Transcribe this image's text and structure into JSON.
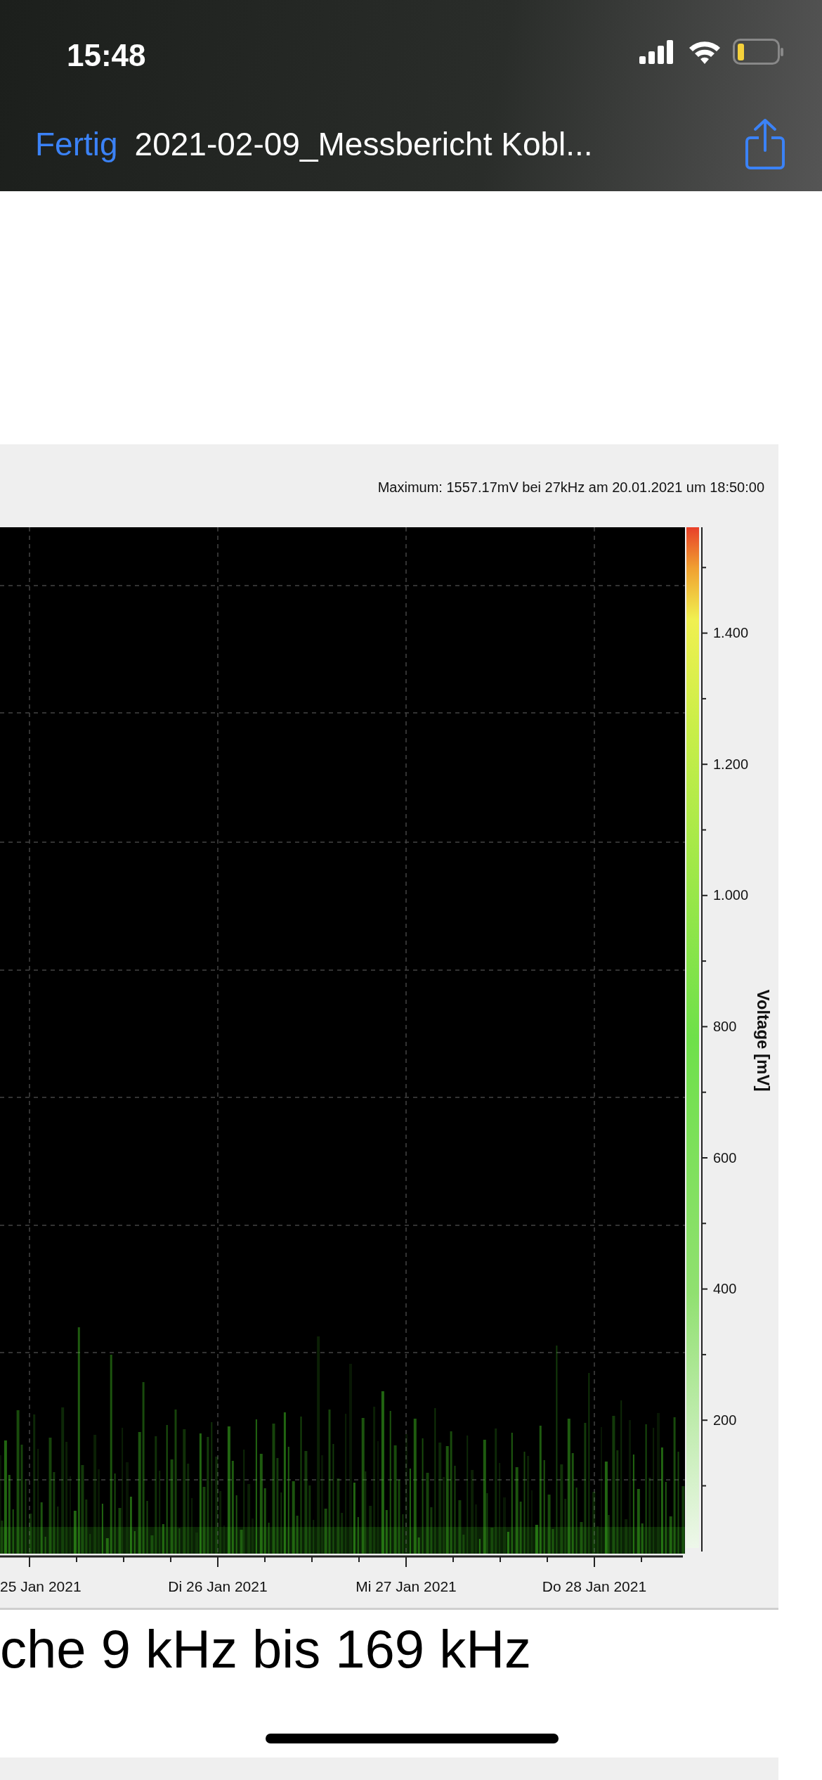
{
  "status_bar": {
    "time": "15:48"
  },
  "nav_bar": {
    "done": "Fertig",
    "title": "2021-02-09_Messbericht Kobl..."
  },
  "chart": {
    "maximum_note": "Maximum: 1557.17mV bei 27kHz am 20.01.2021 um 18:50:00",
    "colorbar": {
      "title": "Voltage [mV]",
      "ticks": [
        "1.400",
        "1.200",
        "1.000",
        "800",
        "600",
        "400",
        "200"
      ]
    },
    "x_labels": [
      "25 Jan 2021",
      "Di 26 Jan 2021",
      "Mi 27 Jan 2021",
      "Do 28 Jan 2021"
    ]
  },
  "heading_bottom": "che 9 kHz bis 169 kHz"
}
